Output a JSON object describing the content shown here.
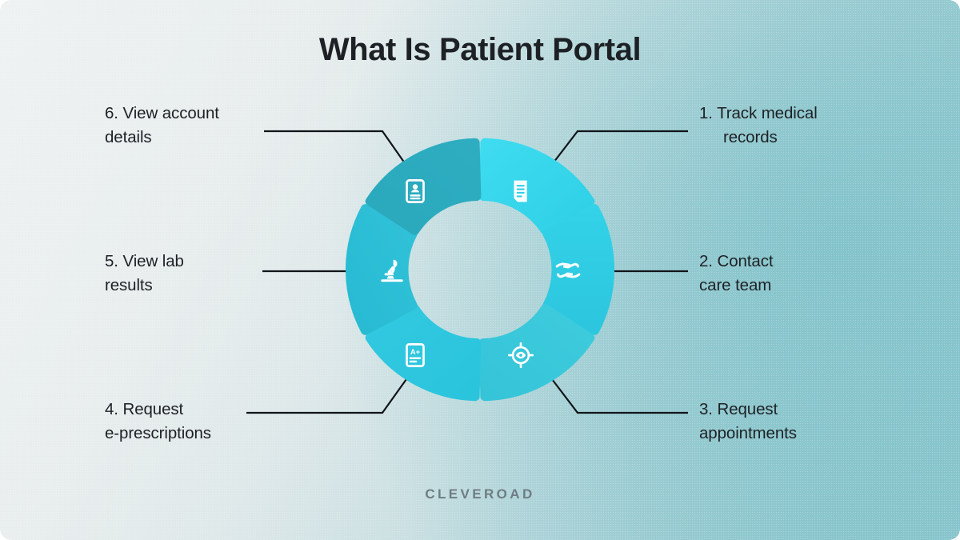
{
  "title": "What Is Patient Portal",
  "brand": "CLEVEROAD",
  "theme": {
    "background_start": "#eef2f2",
    "background_end": "#8ac6cc",
    "text_color": "#1d2125",
    "brand_color": "#6f7d83",
    "connector_color": "#10151a",
    "icon_color": "#ffffff"
  },
  "wheel": {
    "segment_count": 6,
    "center_color": "#cfdcdc",
    "segments": [
      {
        "number": "1",
        "icon": "document-lines-icon",
        "color": "#35d6ec",
        "position": "top-right"
      },
      {
        "number": "2",
        "icon": "caring-hands-icon",
        "color": "#2fcde4",
        "position": "right"
      },
      {
        "number": "3",
        "icon": "eye-target-icon",
        "color": "#3ac8dc",
        "position": "bottom-right"
      },
      {
        "number": "4",
        "icon": "prescription-icon",
        "color": "#2ec6dd",
        "position": "bottom-left"
      },
      {
        "number": "5",
        "icon": "microscope-icon",
        "color": "#2bbdd4",
        "position": "left"
      },
      {
        "number": "6",
        "icon": "id-card-icon",
        "color": "#2aa9bd",
        "position": "top-left"
      }
    ]
  },
  "labels": [
    {
      "line1": "1. Track medical",
      "line2": "records",
      "side": "right",
      "indented": true
    },
    {
      "line1": "2. Contact",
      "line2": "care team",
      "side": "right",
      "indented": false
    },
    {
      "line1": "3. Request",
      "line2": "appointments",
      "side": "right",
      "indented": false
    },
    {
      "line1": "4. Request",
      "line2": "e-prescriptions",
      "side": "left",
      "indented": false
    },
    {
      "line1": "5. View lab",
      "line2": "results",
      "side": "left",
      "indented": false
    },
    {
      "line1": "6. View account",
      "line2": "details",
      "side": "left",
      "indented": false
    }
  ]
}
